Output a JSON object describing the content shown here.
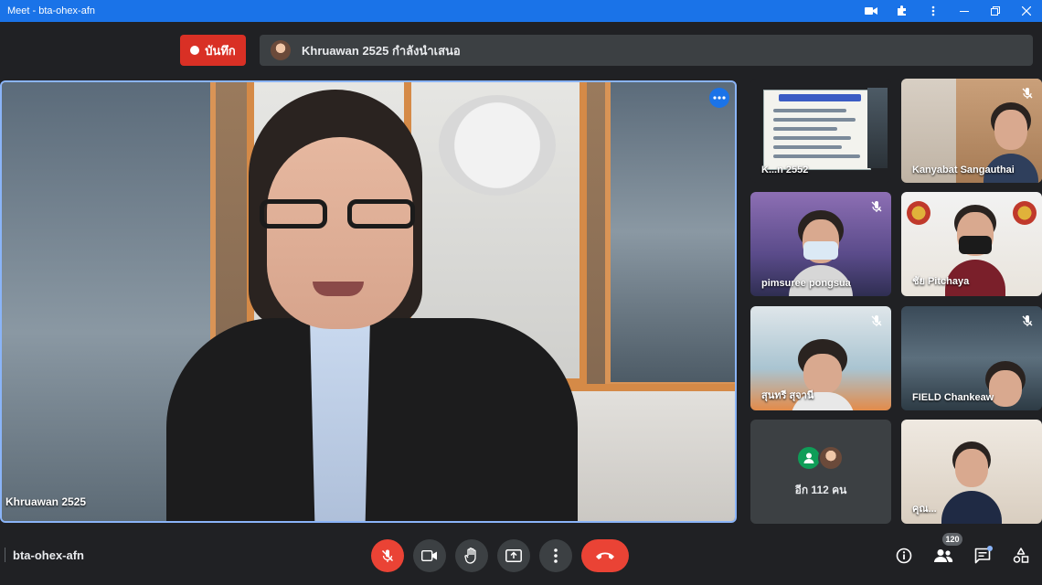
{
  "window": {
    "title": "Meet - bta-ohex-afn"
  },
  "topbar": {
    "record_label": "บันทึก",
    "presenting_text": "Khruawan 2525 กำลังนำเสนอ"
  },
  "main_tile": {
    "name": "Khruawan 2525"
  },
  "tiles": [
    {
      "name": "K...n 2552"
    },
    {
      "name": "Kanyabat Sangauthai"
    },
    {
      "name": "pimsuree pongsua"
    },
    {
      "name": "ชัย Pitchaya"
    },
    {
      "name": "สุนทรี สุจานี"
    },
    {
      "name": "FIELD Chankeaw"
    },
    {
      "name": "คุณ..."
    }
  ],
  "others": {
    "label": "อีก 112 คน"
  },
  "bottombar": {
    "meeting_code": "bta-ohex-afn",
    "participant_count": "120"
  },
  "icons": {
    "mic": "mic-off-icon",
    "camera": "camera-icon",
    "hand": "raise-hand-icon",
    "present": "present-screen-icon",
    "more": "more-vert-icon",
    "hangup": "hangup-icon",
    "info": "info-icon",
    "people": "people-icon",
    "chat": "chat-icon",
    "activities": "activities-icon"
  },
  "colors": {
    "background": "#202124",
    "surface": "#3c4043",
    "accent": "#1a73e8",
    "danger": "#ea4335",
    "speaker_border": "#8ab4f8"
  }
}
